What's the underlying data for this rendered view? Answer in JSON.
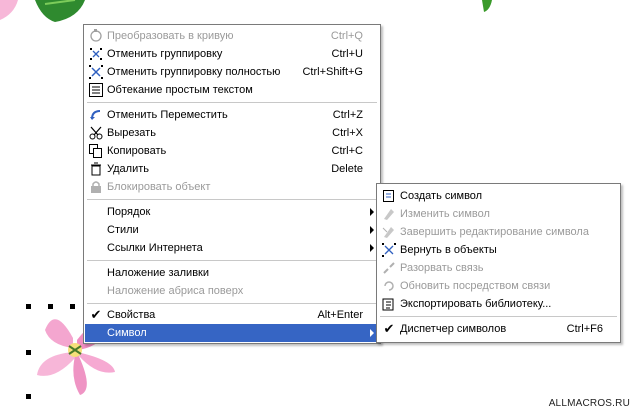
{
  "main_menu": {
    "items": [
      {
        "label": "Преобразовать в кривую",
        "shortcut": "Ctrl+Q",
        "icon": "convert-curve-icon",
        "disabled": true
      },
      {
        "label": "Отменить группировку",
        "shortcut": "Ctrl+U",
        "icon": "ungroup-icon",
        "disabled": false
      },
      {
        "label": "Отменить группировку полностью",
        "shortcut": "Ctrl+Shift+G",
        "icon": "ungroup-all-icon",
        "disabled": false
      },
      {
        "label": "Обтекание простым текстом",
        "shortcut": "",
        "icon": "text-wrap-icon",
        "disabled": false
      },
      {
        "label": "Отменить Переместить",
        "shortcut": "Ctrl+Z",
        "icon": "undo-icon",
        "disabled": false
      },
      {
        "label": "Вырезать",
        "shortcut": "Ctrl+X",
        "icon": "scissors-icon",
        "disabled": false
      },
      {
        "label": "Копировать",
        "shortcut": "Ctrl+C",
        "icon": "copy-icon",
        "disabled": false
      },
      {
        "label": "Удалить",
        "shortcut": "Delete",
        "icon": "trash-icon",
        "disabled": false
      },
      {
        "label": "Блокировать объект",
        "shortcut": "",
        "icon": "lock-icon",
        "disabled": true
      },
      {
        "label": "Порядок",
        "submenu": true,
        "disabled": false
      },
      {
        "label": "Стили",
        "submenu": true,
        "disabled": false
      },
      {
        "label": "Ссылки Интернета",
        "submenu": true,
        "disabled": false
      },
      {
        "label": "Наложение заливки",
        "disabled": false
      },
      {
        "label": "Наложение абриса поверх",
        "disabled": true
      },
      {
        "label": "Свойства",
        "shortcut": "Alt+Enter",
        "checked": true,
        "disabled": false
      },
      {
        "label": "Символ",
        "submenu": true,
        "selected": true,
        "disabled": false
      }
    ]
  },
  "sub_menu": {
    "items": [
      {
        "label": "Создать символ",
        "icon": "create-symbol-icon",
        "disabled": false
      },
      {
        "label": "Изменить символ",
        "icon": "edit-symbol-icon",
        "disabled": true
      },
      {
        "label": "Завершить редактирование символа",
        "icon": "finish-edit-icon",
        "disabled": true
      },
      {
        "label": "Вернуть в объекты",
        "icon": "revert-objects-icon",
        "disabled": false
      },
      {
        "label": "Разорвать связь",
        "icon": "break-link-icon",
        "disabled": true
      },
      {
        "label": "Обновить посредством связи",
        "icon": "update-link-icon",
        "disabled": true
      },
      {
        "label": "Экспортировать библиотеку...",
        "icon": "export-library-icon",
        "disabled": false
      },
      {
        "label": "Диспетчер символов",
        "shortcut": "Ctrl+F6",
        "checked": true,
        "disabled": false
      }
    ]
  },
  "watermark": "ALLMACROS.RU",
  "colors": {
    "highlight": "#3665c4",
    "disabled_text": "#9a9a9a",
    "menu_border": "#7a7a7a"
  }
}
